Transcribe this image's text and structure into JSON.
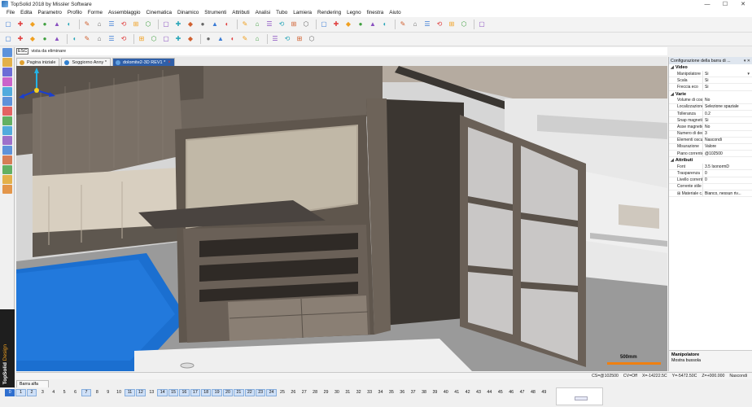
{
  "window": {
    "title": "TopSolid 2018 by Missler Software",
    "controls": [
      "—",
      "☐",
      "✕"
    ]
  },
  "menu": [
    "File",
    "Edita",
    "Parametro",
    "Profilo",
    "Forme",
    "Assemblaggio",
    "Cinematica",
    "Dinamico",
    "Strumenti",
    "Attributi",
    "Analisi",
    "Tubo",
    "Lamiera",
    "Rendering",
    "Legno",
    "finestra",
    "Aiuto"
  ],
  "toolbar1": {
    "icons": [
      "new-file-icon",
      "open-folder-icon",
      "save-icon",
      "import-icon",
      "save-all-icon",
      "print-icon",
      "cut-icon",
      "delete-icon",
      "undo-icon",
      "redo-icon",
      "copy-icon",
      "paste-icon",
      "properties-icon",
      "color-icon",
      "layer-icon",
      "group-icon",
      "visibility-icon",
      "pipe-icon",
      "measure-icon",
      "text-icon",
      "link-icon",
      "pen-icon",
      "check-icon",
      "arrow-icon",
      "zoom-icon",
      "grid-icon",
      "render-icon",
      "rotate-icon",
      "print-preview-icon",
      "cube-icon",
      "light-icon",
      "camera-icon",
      "cylinder-icon",
      "sheet-icon",
      "shade-icon",
      "draw-line-icon",
      "hatch-icon"
    ]
  },
  "toolbar2": {
    "icons": [
      "pencil-icon",
      "line-icon",
      "rectangle-icon",
      "circle-icon",
      "square-icon",
      "polyline-icon",
      "arc-icon",
      "curve-icon",
      "point-icon",
      "offset-icon",
      "extrude-icon",
      "revolve-icon",
      "fillet-icon",
      "chamfer-icon",
      "cut-icon",
      "shell-icon",
      "pattern-icon",
      "mirror-icon",
      "hole-icon",
      "sweep-icon",
      "loft-icon",
      "boolean-icon",
      "section-icon",
      "sketch-icon"
    ]
  },
  "command": {
    "esc_label": "ESC",
    "prompt": "vista da eliminare"
  },
  "tabs": [
    {
      "label": "Pagina iniziale",
      "color": "#e0a030"
    },
    {
      "label": "Soggiorno Anny *",
      "color": "#3080d0"
    },
    {
      "label": "dolomite2-3D REV1 *",
      "color": "#60a0e0",
      "active": true
    }
  ],
  "tab_close": "×",
  "scale": {
    "label": "500mm"
  },
  "status": [
    "CS=@102500",
    "CV=Off",
    "X=-14222.5C",
    "Y=-5472.50C",
    "Z=+000.000",
    "Nascondi"
  ],
  "props": {
    "title": "Configurazione della barra di ...",
    "header_tools": "▾ ✕",
    "sections": [
      {
        "name": "Video",
        "rows": [
          {
            "name": "Manipolatore",
            "value": "Si",
            "dropdown": true
          },
          {
            "name": "Scala",
            "value": "Si"
          },
          {
            "name": "Freccia eco",
            "value": "Si"
          }
        ]
      },
      {
        "name": "Varie",
        "rows": [
          {
            "name": "Volume di costr...",
            "value": "No"
          },
          {
            "name": "Localizzazione",
            "value": "Selezione spaziale"
          },
          {
            "name": "Tolleranza",
            "value": "0.2"
          },
          {
            "name": "Snap magnetico",
            "value": "Si"
          },
          {
            "name": "Asse magnetico",
            "value": "No"
          },
          {
            "name": "Numero di deci...",
            "value": "3"
          },
          {
            "name": "Elementi oscurati",
            "value": "Nascondi"
          },
          {
            "name": "Misurazione",
            "value": "Valore"
          },
          {
            "name": "Piano corrente",
            "value": "@102500"
          }
        ]
      },
      {
        "name": "Attributi",
        "rows": [
          {
            "name": "Font",
            "value": "3.5 IsonormD"
          },
          {
            "name": "Trasparenza",
            "value": "0"
          },
          {
            "name": "Livello corrente",
            "value": "0"
          },
          {
            "name": "Corrente stile d...",
            "value": ""
          },
          {
            "name": "Materiale c...",
            "value": "Bianco, nessun riv...",
            "expandable": true
          }
        ]
      }
    ],
    "description": {
      "title": "Manipolatore",
      "text": "Mostra bussola"
    }
  },
  "brand": {
    "name": "TopSolid",
    "product": "Design"
  },
  "layers": {
    "label": "Barra alfa",
    "current": 0,
    "used": [
      1,
      2,
      7,
      11,
      12,
      14,
      15,
      16,
      17,
      18,
      19,
      20,
      21,
      22,
      23,
      24
    ],
    "count": 50
  },
  "colors": {
    "active_tab": "#2f5fa8",
    "scale_bar": "#f08010",
    "floor": "#1b6fd0"
  }
}
